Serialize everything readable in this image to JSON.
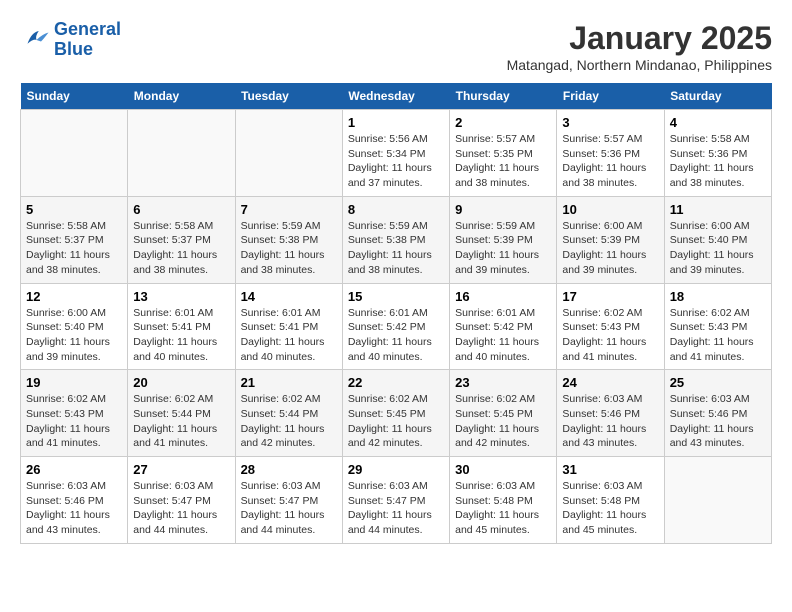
{
  "logo": {
    "line1": "General",
    "line2": "Blue"
  },
  "title": "January 2025",
  "subtitle": "Matangad, Northern Mindanao, Philippines",
  "weekdays": [
    "Sunday",
    "Monday",
    "Tuesday",
    "Wednesday",
    "Thursday",
    "Friday",
    "Saturday"
  ],
  "weeks": [
    [
      {
        "day": "",
        "sunrise": "",
        "sunset": "",
        "daylight": ""
      },
      {
        "day": "",
        "sunrise": "",
        "sunset": "",
        "daylight": ""
      },
      {
        "day": "",
        "sunrise": "",
        "sunset": "",
        "daylight": ""
      },
      {
        "day": "1",
        "sunrise": "Sunrise: 5:56 AM",
        "sunset": "Sunset: 5:34 PM",
        "daylight": "Daylight: 11 hours and 37 minutes."
      },
      {
        "day": "2",
        "sunrise": "Sunrise: 5:57 AM",
        "sunset": "Sunset: 5:35 PM",
        "daylight": "Daylight: 11 hours and 38 minutes."
      },
      {
        "day": "3",
        "sunrise": "Sunrise: 5:57 AM",
        "sunset": "Sunset: 5:36 PM",
        "daylight": "Daylight: 11 hours and 38 minutes."
      },
      {
        "day": "4",
        "sunrise": "Sunrise: 5:58 AM",
        "sunset": "Sunset: 5:36 PM",
        "daylight": "Daylight: 11 hours and 38 minutes."
      }
    ],
    [
      {
        "day": "5",
        "sunrise": "Sunrise: 5:58 AM",
        "sunset": "Sunset: 5:37 PM",
        "daylight": "Daylight: 11 hours and 38 minutes."
      },
      {
        "day": "6",
        "sunrise": "Sunrise: 5:58 AM",
        "sunset": "Sunset: 5:37 PM",
        "daylight": "Daylight: 11 hours and 38 minutes."
      },
      {
        "day": "7",
        "sunrise": "Sunrise: 5:59 AM",
        "sunset": "Sunset: 5:38 PM",
        "daylight": "Daylight: 11 hours and 38 minutes."
      },
      {
        "day": "8",
        "sunrise": "Sunrise: 5:59 AM",
        "sunset": "Sunset: 5:38 PM",
        "daylight": "Daylight: 11 hours and 38 minutes."
      },
      {
        "day": "9",
        "sunrise": "Sunrise: 5:59 AM",
        "sunset": "Sunset: 5:39 PM",
        "daylight": "Daylight: 11 hours and 39 minutes."
      },
      {
        "day": "10",
        "sunrise": "Sunrise: 6:00 AM",
        "sunset": "Sunset: 5:39 PM",
        "daylight": "Daylight: 11 hours and 39 minutes."
      },
      {
        "day": "11",
        "sunrise": "Sunrise: 6:00 AM",
        "sunset": "Sunset: 5:40 PM",
        "daylight": "Daylight: 11 hours and 39 minutes."
      }
    ],
    [
      {
        "day": "12",
        "sunrise": "Sunrise: 6:00 AM",
        "sunset": "Sunset: 5:40 PM",
        "daylight": "Daylight: 11 hours and 39 minutes."
      },
      {
        "day": "13",
        "sunrise": "Sunrise: 6:01 AM",
        "sunset": "Sunset: 5:41 PM",
        "daylight": "Daylight: 11 hours and 40 minutes."
      },
      {
        "day": "14",
        "sunrise": "Sunrise: 6:01 AM",
        "sunset": "Sunset: 5:41 PM",
        "daylight": "Daylight: 11 hours and 40 minutes."
      },
      {
        "day": "15",
        "sunrise": "Sunrise: 6:01 AM",
        "sunset": "Sunset: 5:42 PM",
        "daylight": "Daylight: 11 hours and 40 minutes."
      },
      {
        "day": "16",
        "sunrise": "Sunrise: 6:01 AM",
        "sunset": "Sunset: 5:42 PM",
        "daylight": "Daylight: 11 hours and 40 minutes."
      },
      {
        "day": "17",
        "sunrise": "Sunrise: 6:02 AM",
        "sunset": "Sunset: 5:43 PM",
        "daylight": "Daylight: 11 hours and 41 minutes."
      },
      {
        "day": "18",
        "sunrise": "Sunrise: 6:02 AM",
        "sunset": "Sunset: 5:43 PM",
        "daylight": "Daylight: 11 hours and 41 minutes."
      }
    ],
    [
      {
        "day": "19",
        "sunrise": "Sunrise: 6:02 AM",
        "sunset": "Sunset: 5:43 PM",
        "daylight": "Daylight: 11 hours and 41 minutes."
      },
      {
        "day": "20",
        "sunrise": "Sunrise: 6:02 AM",
        "sunset": "Sunset: 5:44 PM",
        "daylight": "Daylight: 11 hours and 41 minutes."
      },
      {
        "day": "21",
        "sunrise": "Sunrise: 6:02 AM",
        "sunset": "Sunset: 5:44 PM",
        "daylight": "Daylight: 11 hours and 42 minutes."
      },
      {
        "day": "22",
        "sunrise": "Sunrise: 6:02 AM",
        "sunset": "Sunset: 5:45 PM",
        "daylight": "Daylight: 11 hours and 42 minutes."
      },
      {
        "day": "23",
        "sunrise": "Sunrise: 6:02 AM",
        "sunset": "Sunset: 5:45 PM",
        "daylight": "Daylight: 11 hours and 42 minutes."
      },
      {
        "day": "24",
        "sunrise": "Sunrise: 6:03 AM",
        "sunset": "Sunset: 5:46 PM",
        "daylight": "Daylight: 11 hours and 43 minutes."
      },
      {
        "day": "25",
        "sunrise": "Sunrise: 6:03 AM",
        "sunset": "Sunset: 5:46 PM",
        "daylight": "Daylight: 11 hours and 43 minutes."
      }
    ],
    [
      {
        "day": "26",
        "sunrise": "Sunrise: 6:03 AM",
        "sunset": "Sunset: 5:46 PM",
        "daylight": "Daylight: 11 hours and 43 minutes."
      },
      {
        "day": "27",
        "sunrise": "Sunrise: 6:03 AM",
        "sunset": "Sunset: 5:47 PM",
        "daylight": "Daylight: 11 hours and 44 minutes."
      },
      {
        "day": "28",
        "sunrise": "Sunrise: 6:03 AM",
        "sunset": "Sunset: 5:47 PM",
        "daylight": "Daylight: 11 hours and 44 minutes."
      },
      {
        "day": "29",
        "sunrise": "Sunrise: 6:03 AM",
        "sunset": "Sunset: 5:47 PM",
        "daylight": "Daylight: 11 hours and 44 minutes."
      },
      {
        "day": "30",
        "sunrise": "Sunrise: 6:03 AM",
        "sunset": "Sunset: 5:48 PM",
        "daylight": "Daylight: 11 hours and 45 minutes."
      },
      {
        "day": "31",
        "sunrise": "Sunrise: 6:03 AM",
        "sunset": "Sunset: 5:48 PM",
        "daylight": "Daylight: 11 hours and 45 minutes."
      },
      {
        "day": "",
        "sunrise": "",
        "sunset": "",
        "daylight": ""
      }
    ]
  ]
}
